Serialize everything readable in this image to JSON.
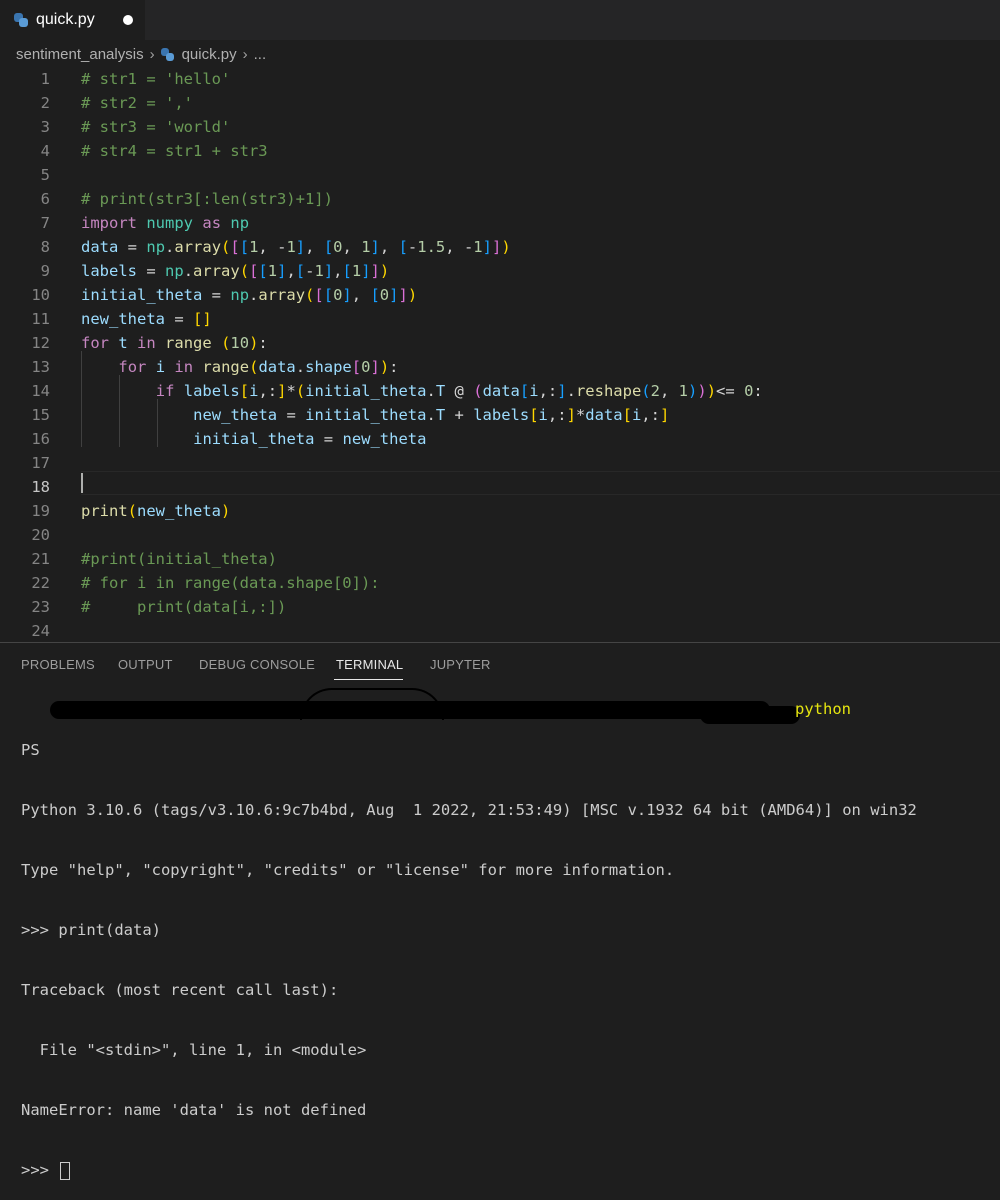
{
  "tab": {
    "filename": "quick.py",
    "dirty": true,
    "icon": "python-icon"
  },
  "breadcrumb": {
    "folder": "sentiment_analysis",
    "file": "quick.py",
    "more": "..."
  },
  "editor": {
    "current_line": 18,
    "lines": [
      {
        "n": "1",
        "text": "# str1 = 'hello'"
      },
      {
        "n": "2",
        "text": "# str2 = ','"
      },
      {
        "n": "3",
        "text": "# str3 = 'world'"
      },
      {
        "n": "4",
        "text": "# str4 = str1 + str3"
      },
      {
        "n": "5",
        "text": ""
      },
      {
        "n": "6",
        "text": "# print(str3[:len(str3)+1])"
      },
      {
        "n": "7",
        "text": "import numpy as np"
      },
      {
        "n": "8",
        "text": "data = np.array([[1, -1], [0, 1], [-1.5, -1]])"
      },
      {
        "n": "9",
        "text": "labels = np.array([[1],[-1],[1]])"
      },
      {
        "n": "10",
        "text": "initial_theta = np.array([[0], [0]])"
      },
      {
        "n": "11",
        "text": "new_theta = []"
      },
      {
        "n": "12",
        "text": "for t in range (10):"
      },
      {
        "n": "13",
        "text": "    for i in range(data.shape[0]):"
      },
      {
        "n": "14",
        "text": "        if labels[i,:]*(initial_theta.T @ (data[i,:].reshape(2, 1)))<= 0:"
      },
      {
        "n": "15",
        "text": "            new_theta = initial_theta.T + labels[i,:]*data[i,:]"
      },
      {
        "n": "16",
        "text": "            initial_theta = new_theta"
      },
      {
        "n": "17",
        "text": ""
      },
      {
        "n": "18",
        "text": ""
      },
      {
        "n": "19",
        "text": "print(new_theta)"
      },
      {
        "n": "20",
        "text": ""
      },
      {
        "n": "21",
        "text": "#print(initial_theta)"
      },
      {
        "n": "22",
        "text": "# for i in range(data.shape[0]):"
      },
      {
        "n": "23",
        "text": "#     print(data[i,:])"
      },
      {
        "n": "24",
        "text": ""
      }
    ]
  },
  "panel": {
    "tabs": [
      "PROBLEMS",
      "OUTPUT",
      "DEBUG CONSOLE",
      "TERMINAL",
      "JUPYTER"
    ],
    "active_tab": "TERMINAL"
  },
  "terminal": {
    "prompt_prefix": "PS",
    "prompt_command": "python",
    "lines": [
      "Python 3.10.6 (tags/v3.10.6:9c7b4bd, Aug  1 2022, 21:53:49) [MSC v.1932 64 bit (AMD64)] on win32",
      "Type \"help\", \"copyright\", \"credits\" or \"license\" for more information.",
      ">>> print(data)",
      "Traceback (most recent call last):",
      "  File \"<stdin>\", line 1, in <module>",
      "NameError: name 'data' is not defined"
    ],
    "prompt": ">>> "
  },
  "colors": {
    "editor_bg": "#1e1e1e",
    "tabbar_bg": "#252526",
    "comment": "#6a9955",
    "keyword": "#c586c0",
    "variable": "#9cdcfe",
    "function": "#dcdcaa",
    "module": "#4ec9b0",
    "number": "#b5cea8"
  }
}
